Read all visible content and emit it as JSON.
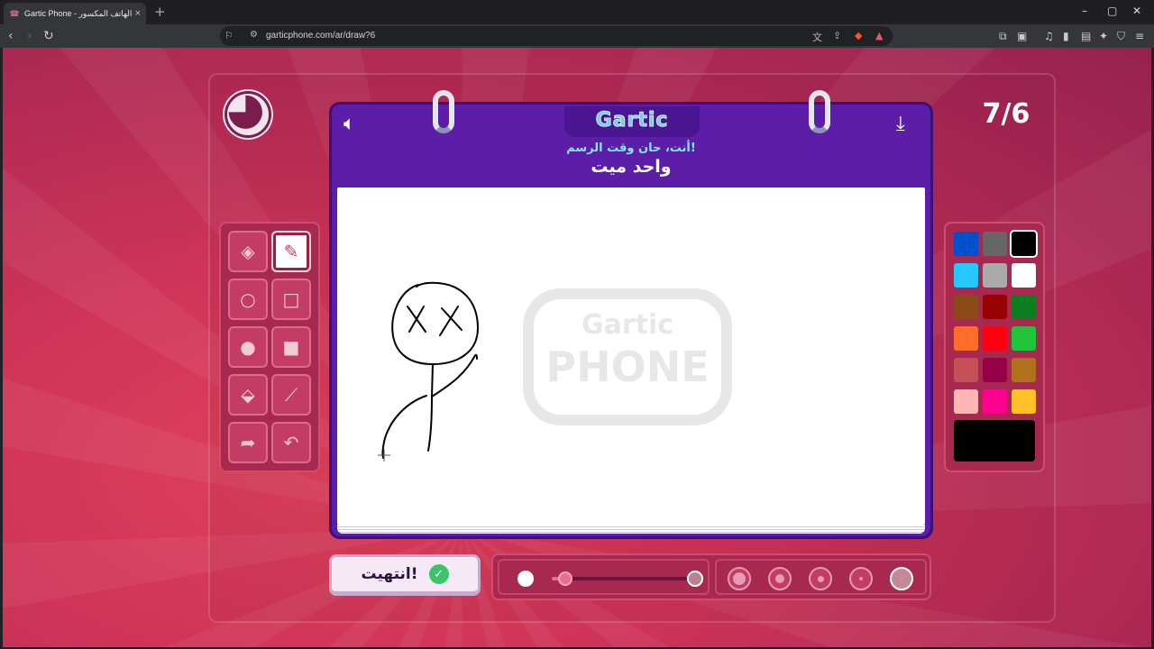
{
  "browser": {
    "tab_title": "Gartic Phone - لعبة الهاتف المكسور",
    "tab_close": "×",
    "new_tab": "+",
    "url": "garticphone.com/ar/draw?6"
  },
  "game": {
    "round": "7/6",
    "logo": "Gartic",
    "instruction": "أنت، حان وقت الرسم!",
    "word": "واحد ميت",
    "done_label": "انتهيت!",
    "canvas_watermark_top": "Gartic",
    "canvas_watermark_bottom": "PHONE",
    "timer_progress": 0.75
  },
  "tools": [
    {
      "name": "eraser-tool",
      "icon": "eraser-icon",
      "active": false
    },
    {
      "name": "pencil-tool",
      "icon": "pencil-icon",
      "active": true
    },
    {
      "name": "ellipse-outline-tool",
      "icon": "circle-outline-icon",
      "active": false
    },
    {
      "name": "rectangle-outline-tool",
      "icon": "square-outline-icon",
      "active": false
    },
    {
      "name": "ellipse-fill-tool",
      "icon": "circle-fill-icon",
      "active": false
    },
    {
      "name": "rectangle-fill-tool",
      "icon": "square-fill-icon",
      "active": false
    },
    {
      "name": "fill-bucket-tool",
      "icon": "bucket-icon",
      "active": false
    },
    {
      "name": "line-tool",
      "icon": "line-icon",
      "active": false
    },
    {
      "name": "redo-tool",
      "icon": "redo-icon",
      "active": false
    },
    {
      "name": "undo-tool",
      "icon": "undo-icon",
      "active": false
    }
  ],
  "palette": [
    "#0050cd",
    "#666666",
    "#000000",
    "#26c9ff",
    "#aaaaaa",
    "#ffffff",
    "#8a4b17",
    "#990000",
    "#0a7d1f",
    "#ff6d2a",
    "#ff0013",
    "#22c43a",
    "#c55158",
    "#950046",
    "#b0701c",
    "#ffb7b5",
    "#ff008f",
    "#ffc126"
  ],
  "selected_color": "#000000",
  "brush": {
    "opacity_level": 0.1,
    "sizes": 5,
    "selected_size_index": 4
  }
}
